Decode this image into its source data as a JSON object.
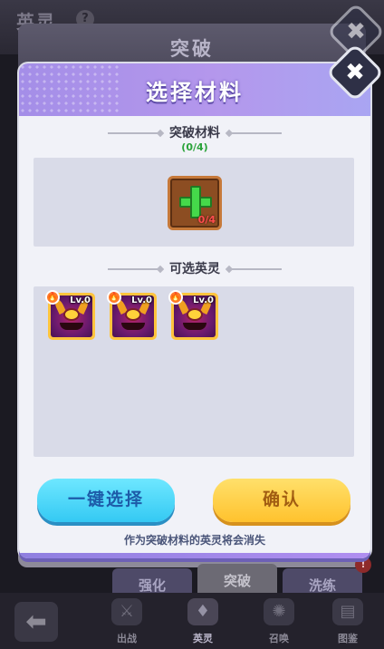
{
  "background": {
    "page_title": "英灵",
    "help_icon": "?",
    "panel_title": "突破",
    "tabs": [
      "强化",
      "突破",
      "洗练"
    ],
    "tab_badge": "!",
    "nav": [
      {
        "icon": "crossed-swords-icon",
        "label": "出战"
      },
      {
        "icon": "hero-icon",
        "label": "英灵"
      },
      {
        "icon": "summon-icon",
        "label": "召唤"
      },
      {
        "icon": "book-icon",
        "label": "图鉴"
      }
    ]
  },
  "modal": {
    "title": "选择材料",
    "material_section": "突破材料",
    "material_progress": "(0/4)",
    "slot_count": "0/4",
    "heroes_section": "可选英灵",
    "heroes": [
      {
        "level": "Lv.0",
        "element": "fire"
      },
      {
        "level": "Lv.0",
        "element": "fire"
      },
      {
        "level": "Lv.0",
        "element": "fire"
      }
    ],
    "one_click_select": "一键选择",
    "confirm": "确认",
    "warning": "作为突破材料的英灵将会消失"
  },
  "colors": {
    "header": "#b497ec",
    "progress_green": "#2aa33a",
    "select_button": "#34c9f3",
    "confirm_button": "#ffc22d",
    "hero_frame": "#ffc43d"
  }
}
